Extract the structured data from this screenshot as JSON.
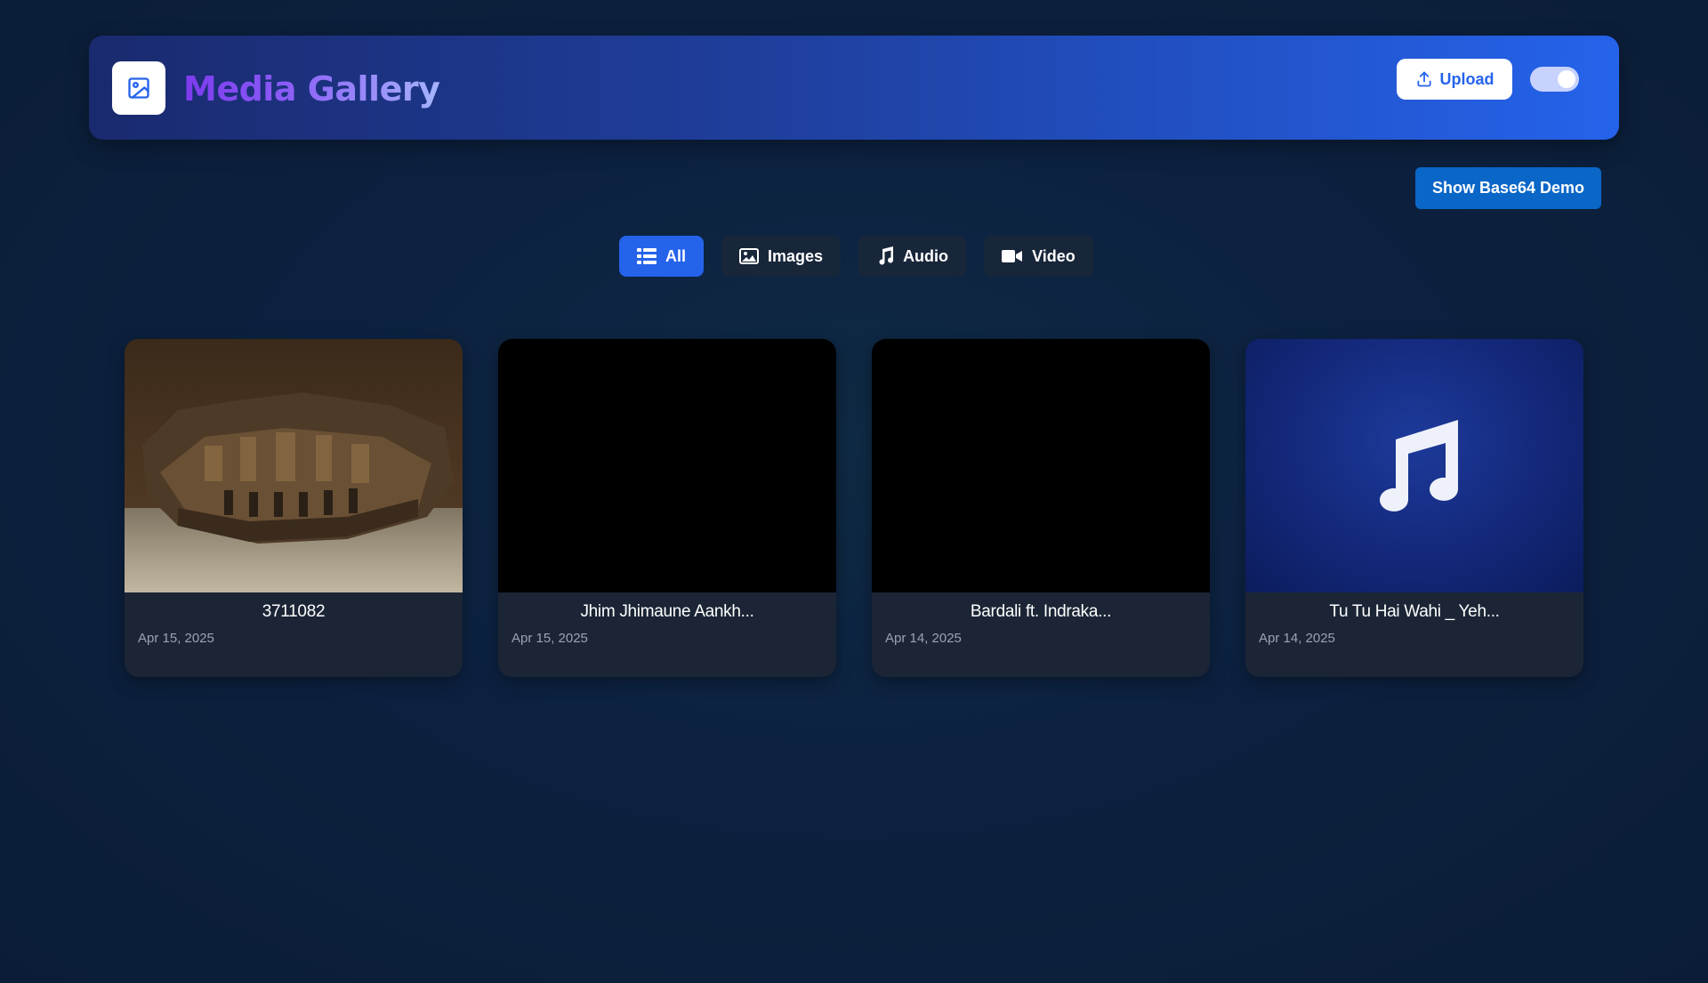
{
  "header": {
    "title": "Media Gallery",
    "upload_label": "Upload",
    "logo_icon": "image-icon",
    "upload_icon": "upload-icon",
    "theme_toggle_on": true
  },
  "base64_button": {
    "label": "Show Base64 Demo"
  },
  "tabs": [
    {
      "label": "All",
      "icon": "list-icon",
      "active": true
    },
    {
      "label": "Images",
      "icon": "image-icon",
      "active": false
    },
    {
      "label": "Audio",
      "icon": "music-note-icon",
      "active": false
    },
    {
      "label": "Video",
      "icon": "video-camera-icon",
      "active": false
    }
  ],
  "cards": [
    {
      "title": "3711082",
      "date": "Apr 15, 2025",
      "type": "image"
    },
    {
      "title": "Jhim Jhimaune Aankh...",
      "date": "Apr 15, 2025",
      "type": "video"
    },
    {
      "title": "Bardali ft. Indraka...",
      "date": "Apr 14, 2025",
      "type": "video"
    },
    {
      "title": "Tu Tu Hai Wahi _ Yeh...",
      "date": "Apr 14, 2025",
      "type": "audio"
    }
  ],
  "colors": {
    "background": "#0c2140",
    "accent": "#2563eb",
    "card": "#1b2535",
    "date_text": "#9aa3b2"
  }
}
